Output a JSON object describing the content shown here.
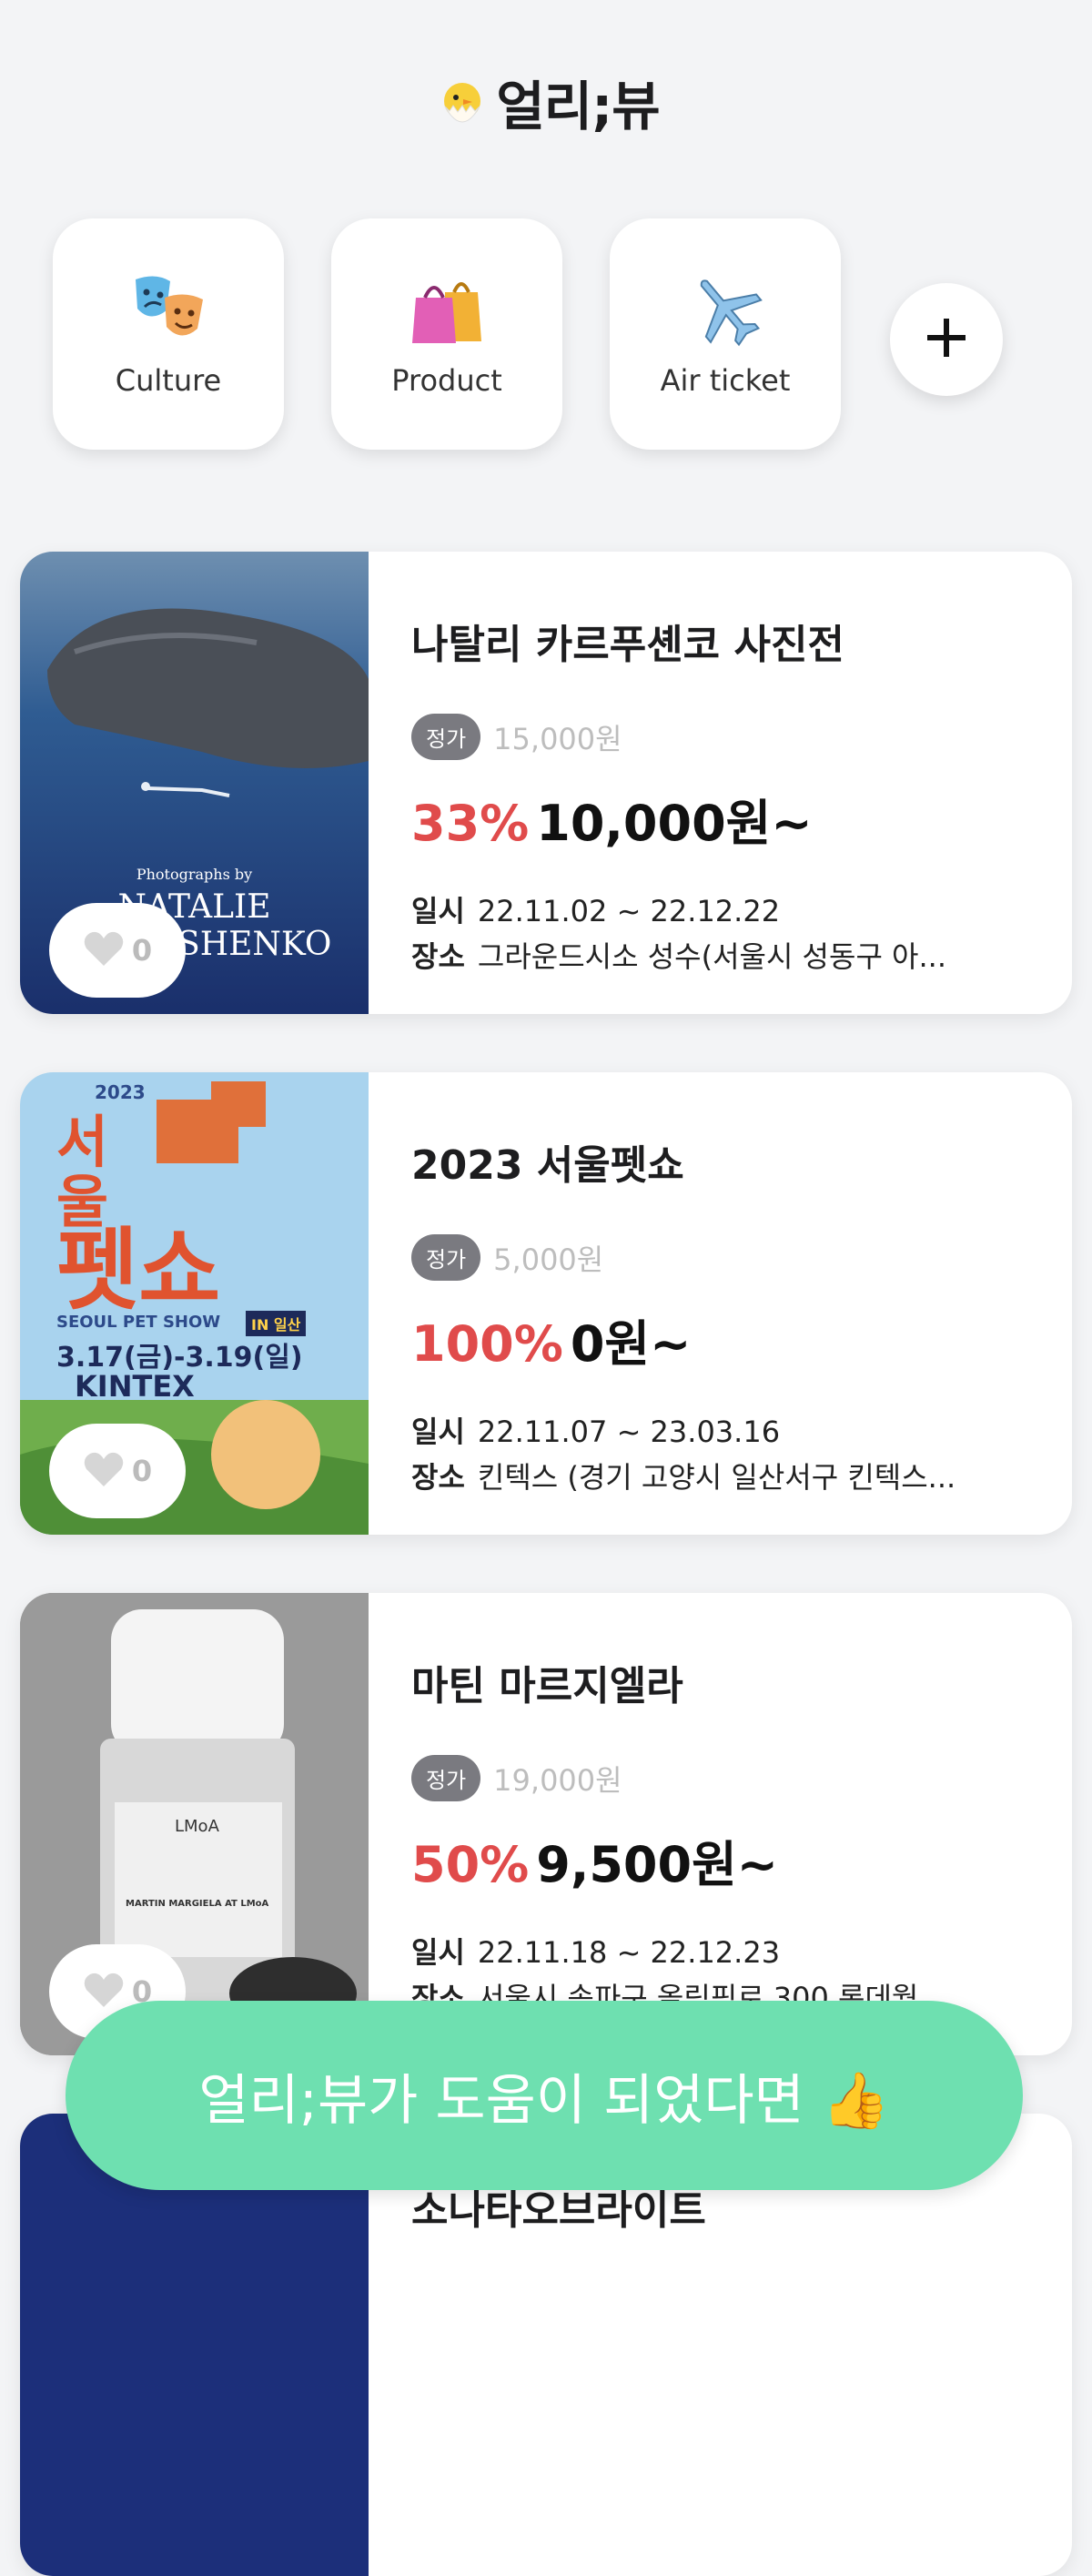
{
  "header": {
    "title": "얼리;뷰"
  },
  "categories": [
    {
      "label": "Culture",
      "icon": "theater-masks-icon"
    },
    {
      "label": "Product",
      "icon": "shopping-bags-icon"
    },
    {
      "label": "Air ticket",
      "icon": "airplane-icon"
    }
  ],
  "add_button": {
    "icon": "plus-icon"
  },
  "listings": [
    {
      "title": "나탈리 카르푸셴코 사진전",
      "badge": "정가",
      "original_price": "15,000원",
      "discount": "33%",
      "sale_price": "10,000원~",
      "date_label": "일시",
      "date": "22.11.02 ~ 22.12.22",
      "place_label": "장소",
      "place": "그라운드시소 성수(서울시 성동구 아...",
      "likes": "0",
      "poster_text": [
        "Photographs by",
        "NATALIE",
        "KARPUSHENKO"
      ]
    },
    {
      "title": "2023 서울펫쇼",
      "badge": "정가",
      "original_price": "5,000원",
      "discount": "100%",
      "sale_price": "0원~",
      "date_label": "일시",
      "date": "22.11.07 ~ 23.03.16",
      "place_label": "장소",
      "place": "킨텍스 (경기 고양시 일산서구 킨텍스...",
      "likes": "0",
      "poster_text": [
        "2023",
        "서울",
        "펫쇼",
        "SEOUL PET SHOW",
        "IN 일산",
        "3.17(금)-3.19(일)",
        "KINTEX"
      ]
    },
    {
      "title": "마틴 마르지엘라",
      "badge": "정가",
      "original_price": "19,000원",
      "discount": "50%",
      "sale_price": "9,500원~",
      "date_label": "일시",
      "date": "22.11.18 ~ 22.12.23",
      "place_label": "장소",
      "place": "서울시 송파구 올림픽로 300 롯데월...",
      "likes": "0",
      "poster_text": [
        "LMoA",
        "MARTIN MARGIELA AT LMoA"
      ]
    },
    {
      "title": "소나타오브라이트"
    }
  ],
  "fab": {
    "label": "얼리;뷰가 도움이 되었다면 👍"
  },
  "colors": {
    "discount": "#e04b4b",
    "fab": "#6ee0b0",
    "badge": "#7a7a80",
    "background": "#f3f4f6"
  }
}
